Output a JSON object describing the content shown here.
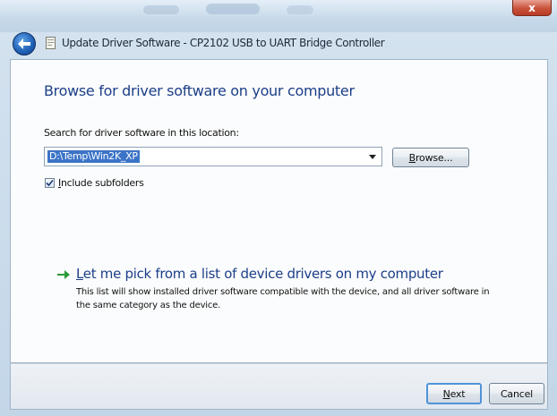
{
  "window": {
    "title": "Update Driver Software - CP2102 USB to UART Bridge Controller",
    "close_glyph": "x"
  },
  "page": {
    "heading": "Browse for driver software on your computer",
    "search_label": "Search for driver software in this location:",
    "path_value": "D:\\Temp\\Win2K_XP",
    "browse_prefix": "B",
    "browse_rest": "rowse...",
    "include_subfolders": {
      "checked": true,
      "prefix": "I",
      "rest": "nclude subfolders"
    },
    "pick": {
      "title_prefix": "L",
      "title_rest": "et me pick from a list of device drivers on my computer",
      "description": "This list will show installed driver software compatible with the device, and all driver software in the same category as the device."
    }
  },
  "footer": {
    "next_prefix": "N",
    "next_rest": "ext",
    "cancel_label": "Cancel"
  },
  "colors": {
    "link_blue": "#1c3f88",
    "selection_blue": "#3b74c7",
    "arrow_green": "#2a9a3a",
    "close_red": "#c9523b"
  },
  "icons": [
    "back-arrow-icon",
    "document-icon",
    "close-icon",
    "chevron-down-icon",
    "checkmark-icon",
    "green-arrow-icon"
  ]
}
